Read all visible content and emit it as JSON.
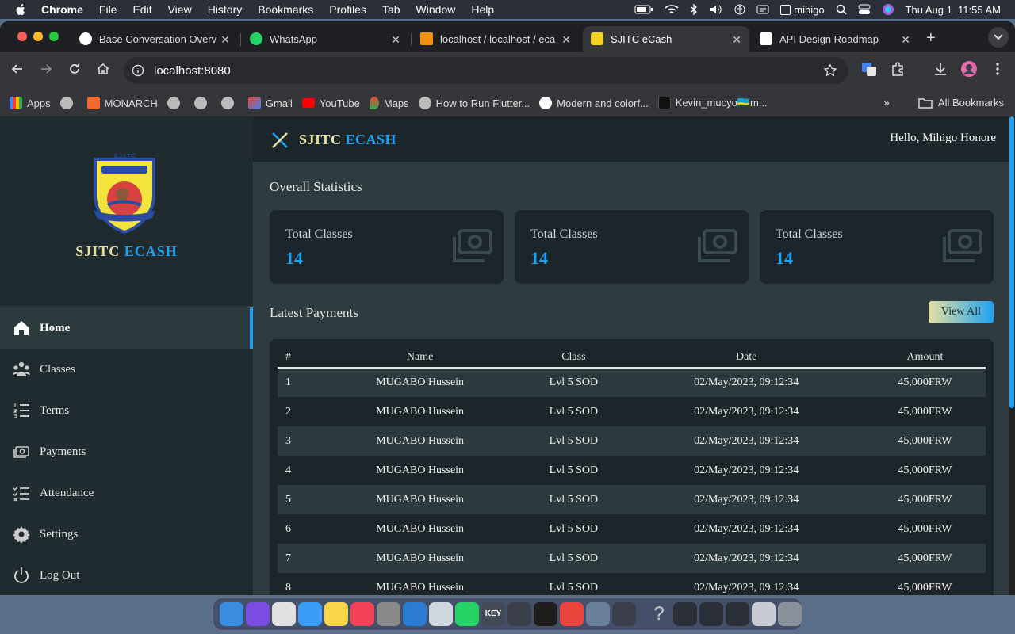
{
  "menubar": {
    "app": "Chrome",
    "items": [
      "File",
      "Edit",
      "View",
      "History",
      "Bookmarks",
      "Profiles",
      "Tab",
      "Window",
      "Help"
    ],
    "user": "mihigo",
    "datetime": "Thu Aug 1  11:55 AM"
  },
  "tabs": [
    {
      "title": "Base Conversation Overv",
      "icon_color": "#ffffff"
    },
    {
      "title": "WhatsApp",
      "icon_color": "#25d366"
    },
    {
      "title": "localhost / localhost / eca",
      "icon_color": "#f29111"
    },
    {
      "title": "SJITC eCash",
      "icon_color": "#f2d21f",
      "active": true
    },
    {
      "title": "API Design Roadmap",
      "icon_color": "#ffffff"
    }
  ],
  "address": {
    "url": "localhost:8080"
  },
  "bookmarks": [
    {
      "label": "Apps",
      "icon": "apps-grid-icon"
    },
    {
      "label": "",
      "icon": "globe-icon"
    },
    {
      "label": "MONARCH",
      "icon": "monarch-icon"
    },
    {
      "label": "",
      "icon": "globe-icon"
    },
    {
      "label": "",
      "icon": "globe-icon"
    },
    {
      "label": "",
      "icon": "globe-icon"
    },
    {
      "label": "Gmail",
      "icon": "gmail-icon"
    },
    {
      "label": "YouTube",
      "icon": "youtube-icon"
    },
    {
      "label": "Maps",
      "icon": "maps-icon"
    },
    {
      "label": "How to Run Flutter...",
      "icon": "globe-icon"
    },
    {
      "label": "Modern and colorf...",
      "icon": "w-icon"
    },
    {
      "label": "Kevin_mucyo🇷🇼m...",
      "icon": "tiktok-icon"
    }
  ],
  "all_bookmarks": "All Bookmarks",
  "app": {
    "brand_first": "SJITC",
    "brand_second": "ECASH",
    "greeting": "Hello, Mihigo Honore",
    "logo_text": "S.J.I.T.C",
    "nav": [
      {
        "label": "Home",
        "icon": "home-icon",
        "active": true
      },
      {
        "label": "Classes",
        "icon": "classes-icon"
      },
      {
        "label": "Terms",
        "icon": "terms-list-icon"
      },
      {
        "label": "Payments",
        "icon": "money-icon"
      },
      {
        "label": "Attendance",
        "icon": "checklist-icon"
      },
      {
        "label": "Settings",
        "icon": "gear-icon"
      },
      {
        "label": "Log Out",
        "icon": "power-icon"
      }
    ],
    "stats_title": "Overall Statistics",
    "stats": [
      {
        "label": "Total Classes",
        "value": "14",
        "icon": "money-icon"
      },
      {
        "label": "Total Classes",
        "value": "14",
        "icon": "money-icon"
      },
      {
        "label": "Total Classes",
        "value": "14",
        "icon": "money-icon"
      }
    ],
    "payments_title": "Latest Payments",
    "view_all": "View All",
    "columns": [
      "#",
      "Name",
      "Class",
      "Date",
      "Amount"
    ],
    "rows": [
      [
        "1",
        "MUGABO Hussein",
        "Lvl 5 SOD",
        "02/May/2023, 09:12:34",
        "45,000FRW"
      ],
      [
        "2",
        "MUGABO Hussein",
        "Lvl 5 SOD",
        "02/May/2023, 09:12:34",
        "45,000FRW"
      ],
      [
        "3",
        "MUGABO Hussein",
        "Lvl 5 SOD",
        "02/May/2023, 09:12:34",
        "45,000FRW"
      ],
      [
        "4",
        "MUGABO Hussein",
        "Lvl 5 SOD",
        "02/May/2023, 09:12:34",
        "45,000FRW"
      ],
      [
        "5",
        "MUGABO Hussein",
        "Lvl 5 SOD",
        "02/May/2023, 09:12:34",
        "45,000FRW"
      ],
      [
        "6",
        "MUGABO Hussein",
        "Lvl 5 SOD",
        "02/May/2023, 09:12:34",
        "45,000FRW"
      ],
      [
        "7",
        "MUGABO Hussein",
        "Lvl 5 SOD",
        "02/May/2023, 09:12:34",
        "45,000FRW"
      ],
      [
        "8",
        "MUGABO Hussein",
        "Lvl 5 SOD",
        "02/May/2023, 09:12:34",
        "45,000FRW"
      ]
    ]
  },
  "colors": {
    "accent": "#1da1f2",
    "brand_yellow": "#e6e0a0",
    "sidebar_bg": "#202b2f",
    "content_bg": "#2e3c40",
    "card_bg": "#1c262a"
  },
  "dock": [
    {
      "icon": "finder-icon",
      "color": "#3a8dde"
    },
    {
      "icon": "siri-icon",
      "color": "#7a4de0"
    },
    {
      "icon": "launchpad-icon",
      "color": "#e0e0e0"
    },
    {
      "icon": "mail-icon",
      "color": "#3b9cf5"
    },
    {
      "icon": "notes-icon",
      "color": "#f7d64a"
    },
    {
      "icon": "music-icon",
      "color": "#f5405a"
    },
    {
      "icon": "system-settings-icon",
      "color": "#8a8a8a"
    },
    {
      "icon": "vscode-icon",
      "color": "#2a7bd4"
    },
    {
      "icon": "app-gear-icon",
      "color": "#d0d6de"
    },
    {
      "icon": "whatsapp-icon",
      "color": "#25d366"
    },
    {
      "icon": "keychain-icon",
      "color": "#444a55"
    },
    {
      "icon": "window-icon",
      "color": "#3a3f4a"
    },
    {
      "icon": "figma-icon",
      "color": "#1e1e1e"
    },
    {
      "icon": "chrome-icon",
      "color": "#e8453c"
    },
    {
      "icon": "preview-icon",
      "color": "#6a7f9a"
    },
    {
      "icon": "window-icon",
      "color": "#3a3f4a"
    },
    {
      "icon": "help-icon",
      "color": "transparent"
    },
    {
      "icon": "keyboard-icon",
      "color": "#2a2f38"
    },
    {
      "icon": "keyboard-icon",
      "color": "#2a2f38"
    },
    {
      "icon": "keyboard-icon",
      "color": "#2a2f38"
    },
    {
      "icon": "screenshot-icon",
      "color": "#c8ccd2"
    },
    {
      "icon": "trash-icon",
      "color": "#8a9099"
    }
  ]
}
